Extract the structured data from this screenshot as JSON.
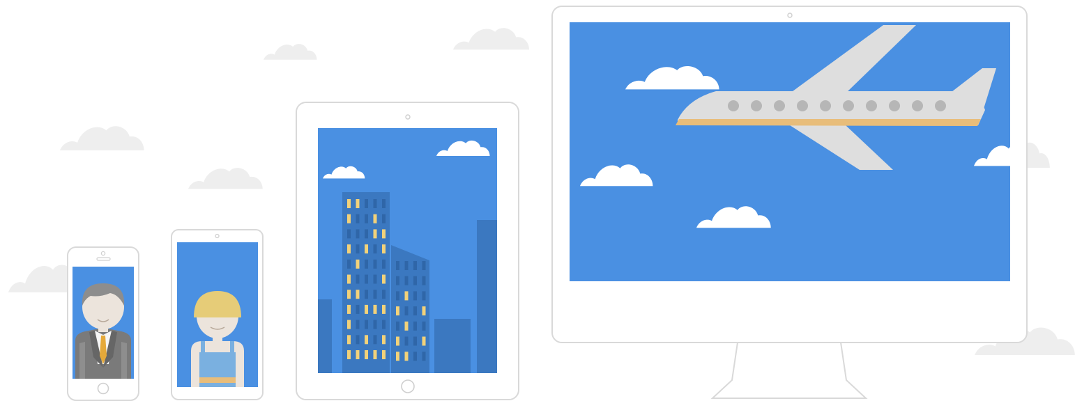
{
  "illustration": {
    "devices": [
      "phone",
      "tablet-phone",
      "tablet",
      "desktop-monitor"
    ],
    "colors": {
      "sky": "#4a90e2",
      "device_outline": "#d9d9d9",
      "background_cloud": "#eeeeee",
      "screen_cloud": "#ffffff",
      "building_dark": "#3b78c0",
      "building_medium": "#3f7fca",
      "window_lit": "#f2d27a",
      "window_dark": "#2f66a8",
      "plane_body": "#dedede",
      "plane_stripe": "#e8bd7a",
      "plane_window": "#b6b6b6",
      "suit": "#7a7a7a",
      "tie": "#e5a93a",
      "hard_hat": "#e6cc78",
      "overalls": "#7ab0e0",
      "skin": "#ece4dc",
      "hair_gray": "#8d8d8d"
    },
    "icons": [
      "businessman-avatar",
      "worker-avatar",
      "city-skyline",
      "airplane",
      "cloud"
    ]
  }
}
